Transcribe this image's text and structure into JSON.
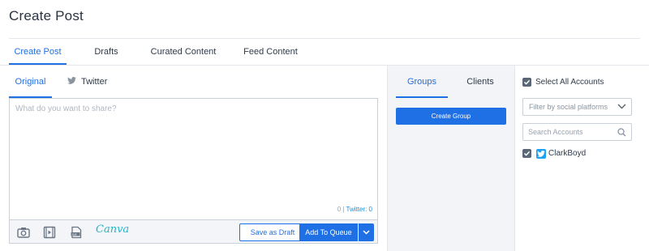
{
  "page": {
    "title": "Create Post"
  },
  "main_tabs": [
    {
      "label": "Create Post",
      "active": true
    },
    {
      "label": "Drafts",
      "active": false
    },
    {
      "label": "Curated Content",
      "active": false
    },
    {
      "label": "Feed Content",
      "active": false
    }
  ],
  "compose": {
    "tabs": [
      {
        "label": "Original",
        "active": true
      },
      {
        "label": "Twitter",
        "active": false,
        "icon": "twitter-bird-icon"
      }
    ],
    "placeholder": "What do you want to share?",
    "value": "",
    "counter": {
      "total": "0",
      "separator": " | ",
      "twitter": "Twitter: 0"
    },
    "toolbar": {
      "icons": [
        "camera-icon",
        "video-icon",
        "gif-icon"
      ],
      "canva_label": "Canva",
      "draft_label": "Save as Draft",
      "queue_label": "Add To Queue"
    }
  },
  "groups": {
    "tabs": [
      {
        "label": "Groups",
        "active": true
      },
      {
        "label": "Clients",
        "active": false
      }
    ],
    "create_label": "Create Group"
  },
  "accounts": {
    "select_all_label": "Select All Accounts",
    "select_all_checked": true,
    "filter_placeholder": "Filter by social platforms",
    "search_placeholder": "Search Accounts",
    "list": [
      {
        "name": "ClarkBoyd",
        "platform": "twitter",
        "checked": true
      }
    ]
  },
  "colors": {
    "accent": "#1f6fe5",
    "twitter": "#1da1f2",
    "canva": "#28b4c8",
    "panel_bg": "#f2f4f7"
  }
}
